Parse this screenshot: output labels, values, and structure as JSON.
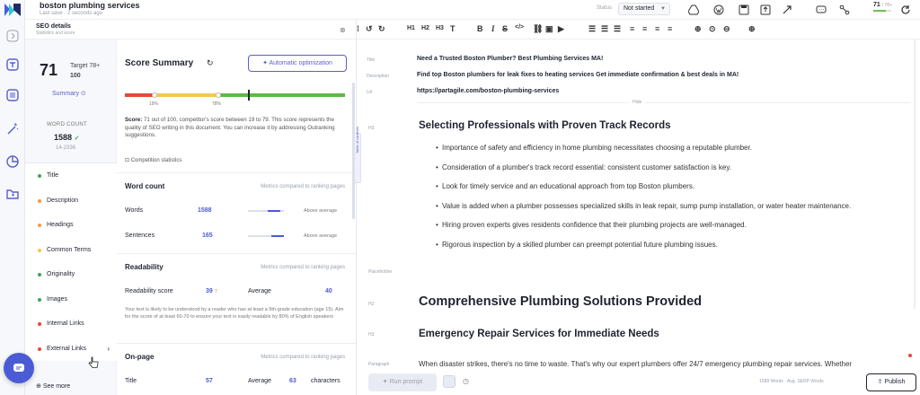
{
  "header": {
    "doc_title": "boston plumbing services",
    "last_save": "Last save · 2 seconds ago",
    "status_label": "Status",
    "status_value": "Not started",
    "score_mini": "71",
    "score_mini_target": "/ 78+"
  },
  "seo_panel": {
    "title": "SEO details",
    "subtitle": "Statistics and score"
  },
  "sidebar": {
    "score": "71",
    "target_label": "Target 78+",
    "target_max": "100",
    "summary_label": "Summary",
    "wordcount_label": "WORD COUNT",
    "wordcount_value": "1588",
    "wordcount_range": "14-2336",
    "items": [
      {
        "label": "Title",
        "color": "#3aa55d"
      },
      {
        "label": "Description",
        "color": "#f2994a"
      },
      {
        "label": "Headings",
        "color": "#f2994a"
      },
      {
        "label": "Common Terms",
        "color": "#f2c94c"
      },
      {
        "label": "Originality",
        "color": "#3aa55d"
      },
      {
        "label": "Images",
        "color": "#3aa55d"
      },
      {
        "label": "Internal Links",
        "color": "#e24a3b"
      },
      {
        "label": "External Links",
        "color": "#e24a3b"
      }
    ],
    "see_more": "See more"
  },
  "score_summary": {
    "title": "Score Summary",
    "auto_btn": "Automatic optimization",
    "mark19": "19%",
    "mark78": "78%",
    "desc_bold": "Score:",
    "desc": " 71 out of 100, competitor's score between 19 to 79. This score represents the quality of SEO writing in this document. You can increase it by addressing Outranking suggestions.",
    "competition_stats": "Competition statistics"
  },
  "word_count": {
    "title": "Word count",
    "note": "Metrics compared to ranking pages",
    "words_label": "Words",
    "words_value": "1588",
    "words_status": "Above average",
    "sentences_label": "Sentences",
    "sentences_value": "165",
    "sentences_status": "Above average"
  },
  "readability": {
    "title": "Readability",
    "note": "Metrics compared to ranking pages",
    "score_label": "Readability score",
    "score_value": "39",
    "avg_label": "Average",
    "avg_value": "40",
    "desc": "Your text is likely to be understood by a reader who has at least a 9th-grade education (age 15). Aim for the score of at least 60-70 to ensure your text is easily readable by 80% of English speakers"
  },
  "onpage": {
    "title": "On-page",
    "note": "Metrics compared to ranking pages",
    "title_label": "Title",
    "title_value": "57",
    "avg_label": "Average",
    "avg_value": "63",
    "unit": "characters"
  },
  "editor": {
    "toc_label": "Table of contents",
    "meta_title_label": "Title",
    "meta_title": "Need a Trusted Boston Plumber? Best Plumbing Services MA!",
    "meta_desc_label": "Description",
    "meta_desc": "Find top Boston plumbers for leak fixes to heating services Get immediate confirmation & best deals in MA!",
    "meta_url_label": "Url",
    "meta_url": "https://partagile.com/boston-plumbing-services",
    "hide_label": "Hide",
    "h3_tag": "H3",
    "h3_a": "Selecting Professionals with Proven Track Records",
    "bullets": [
      "Importance of safety and efficiency in home plumbing necessitates choosing a reputable plumber.",
      "Consideration of a plumber's track record essential: consistent customer satisfaction is key.",
      "Look for timely service and an educational approach from top Boston plumbers.",
      "Value is added when a plumber possesses specialized skills in leak repair, sump pump installation, or water heater maintenance.",
      "Hiring proven experts gives residents confidence that their plumbing projects are well-managed.",
      "Rigorous inspection by a skilled plumber can preempt potential future plumbing issues."
    ],
    "placeholder_tag": "Placeholder",
    "h2_tag": "H2",
    "h2": "Comprehensive Plumbing Solutions Provided",
    "h3_b_tag": "H3",
    "h3_b": "Emergency Repair Services for Immediate Needs",
    "para_tag": "Paragraph",
    "para": "When disaster strikes, there's no time to waste. That's why our expert plumbers offer 24/7 emergency plumbing repair services. Whether"
  },
  "bottom": {
    "run_prompt": "Run prompt",
    "words_info": "1588 Words · Avg. SERP Words",
    "publish": "Publish"
  }
}
